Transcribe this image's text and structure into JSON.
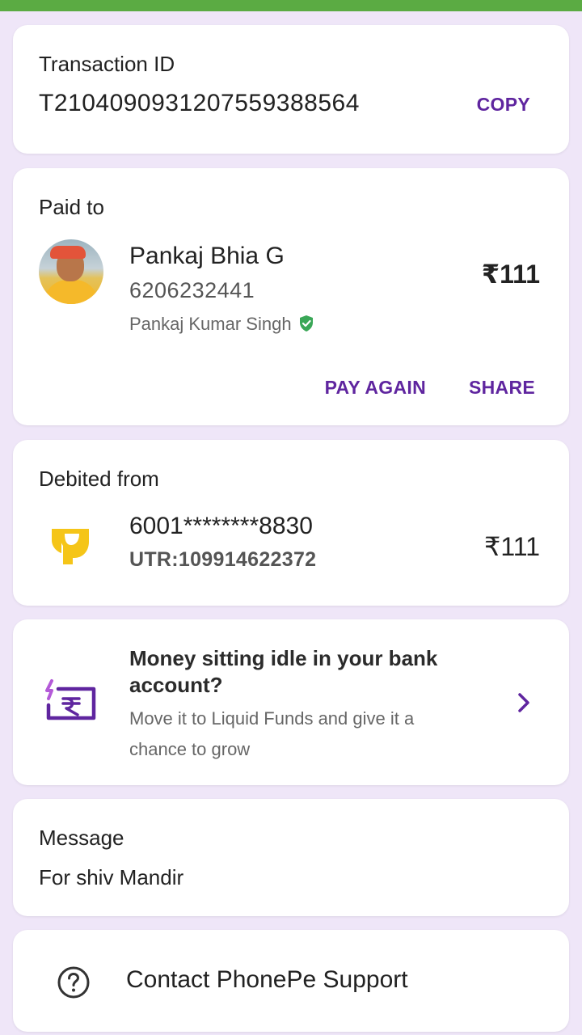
{
  "transaction": {
    "label": "Transaction ID",
    "id": "T2104090931207559388564",
    "copy_label": "COPY"
  },
  "paid_to": {
    "label": "Paid to",
    "name": "Pankaj Bhia G",
    "phone": "6206232441",
    "verified_name": "Pankaj Kumar Singh",
    "amount": "₹111",
    "pay_again_label": "PAY AGAIN",
    "share_label": "SHARE"
  },
  "debited_from": {
    "label": "Debited from",
    "account": "6001********8830",
    "utr": "UTR:109914622372",
    "amount": "₹111"
  },
  "promo": {
    "title": "Money sitting idle in your bank account?",
    "description": "Move it to Liquid Funds and give it a chance to grow"
  },
  "message": {
    "label": "Message",
    "text": "For shiv Mandir"
  },
  "support": {
    "label": "Contact PhonePe Support"
  },
  "icons": {
    "verified": "shield-check-icon",
    "bank": "bank-logo-icon",
    "promo": "rupee-wallet-icon",
    "chevron": "chevron-right-icon",
    "help": "question-circle-icon"
  },
  "colors": {
    "status_bar": "#5bab43",
    "accent": "#5f259f",
    "background": "#efe6f8",
    "verified": "#3aa757",
    "bank_logo": "#f5c518"
  }
}
